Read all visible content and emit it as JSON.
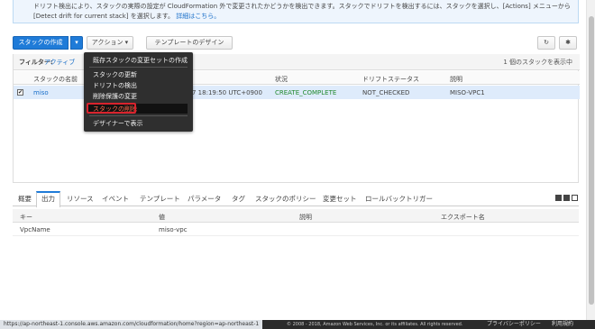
{
  "notice": {
    "line1": "ドリフト検出により、スタックの実際の設定が CloudFormation 外で変更されたかどうかを検出できます。スタックでドリフトを検出するには、スタックを選択し、[Actions] メニューから",
    "line2_prefix": "[Detect drift for current stack] を選択します。",
    "line2_link": "詳細はこちら。"
  },
  "toolbar": {
    "create_label": "スタックの作成",
    "create_arrow": "▾",
    "actions_label": "アクション ▾",
    "template_label": "テンプレートのデザイン",
    "refresh_icon": "↻",
    "settings_icon": "✱"
  },
  "filter": {
    "label": "フィルター:",
    "value": "アクティブ",
    "count_text": "1 個のスタックを表示中"
  },
  "table": {
    "headers": {
      "name": "スタックの名前",
      "status": "状況",
      "drift": "ドリフトステータス",
      "description": "説明"
    },
    "row": {
      "check": "✔",
      "name": "miso",
      "created": "7 18:19:50 UTC+0900",
      "status": "CREATE_COMPLETE",
      "drift": "NOT_CHECKED",
      "description": "MISO-VPC1"
    }
  },
  "actions_menu": {
    "items": [
      "既存スタックの変更セットの作成",
      "スタックの更新",
      "ドリフトの検出",
      "削除保護の変更",
      "スタックの削除",
      "デザイナーで表示"
    ]
  },
  "tabs": [
    "概要",
    "出力",
    "リソース",
    "イベント",
    "テンプレート",
    "パラメータ",
    "タグ",
    "スタックのポリシー",
    "変更セット",
    "ロールバックトリガー"
  ],
  "active_tab": "出力",
  "outputs": {
    "headers": {
      "key": "キー",
      "value": "値",
      "description": "説明",
      "export": "エクスポート名"
    },
    "rows": [
      {
        "key": "VpcName",
        "value": "miso-vpc",
        "description": "",
        "export": ""
      }
    ]
  },
  "footer": {
    "status_url": "https://ap-northeast-1.console.aws.amazon.com/cloudformation/home?region=ap-northeast-1",
    "copyright": "© 2008 - 2018, Amazon Web Services, Inc. or its affiliates. All rights reserved.",
    "privacy": "プライバシーポリシー",
    "terms": "利用規約"
  },
  "colors": {
    "primary": "#1f7bd8",
    "success": "#20882c",
    "danger": "#d9232d",
    "selected_row": "#deebfb"
  }
}
